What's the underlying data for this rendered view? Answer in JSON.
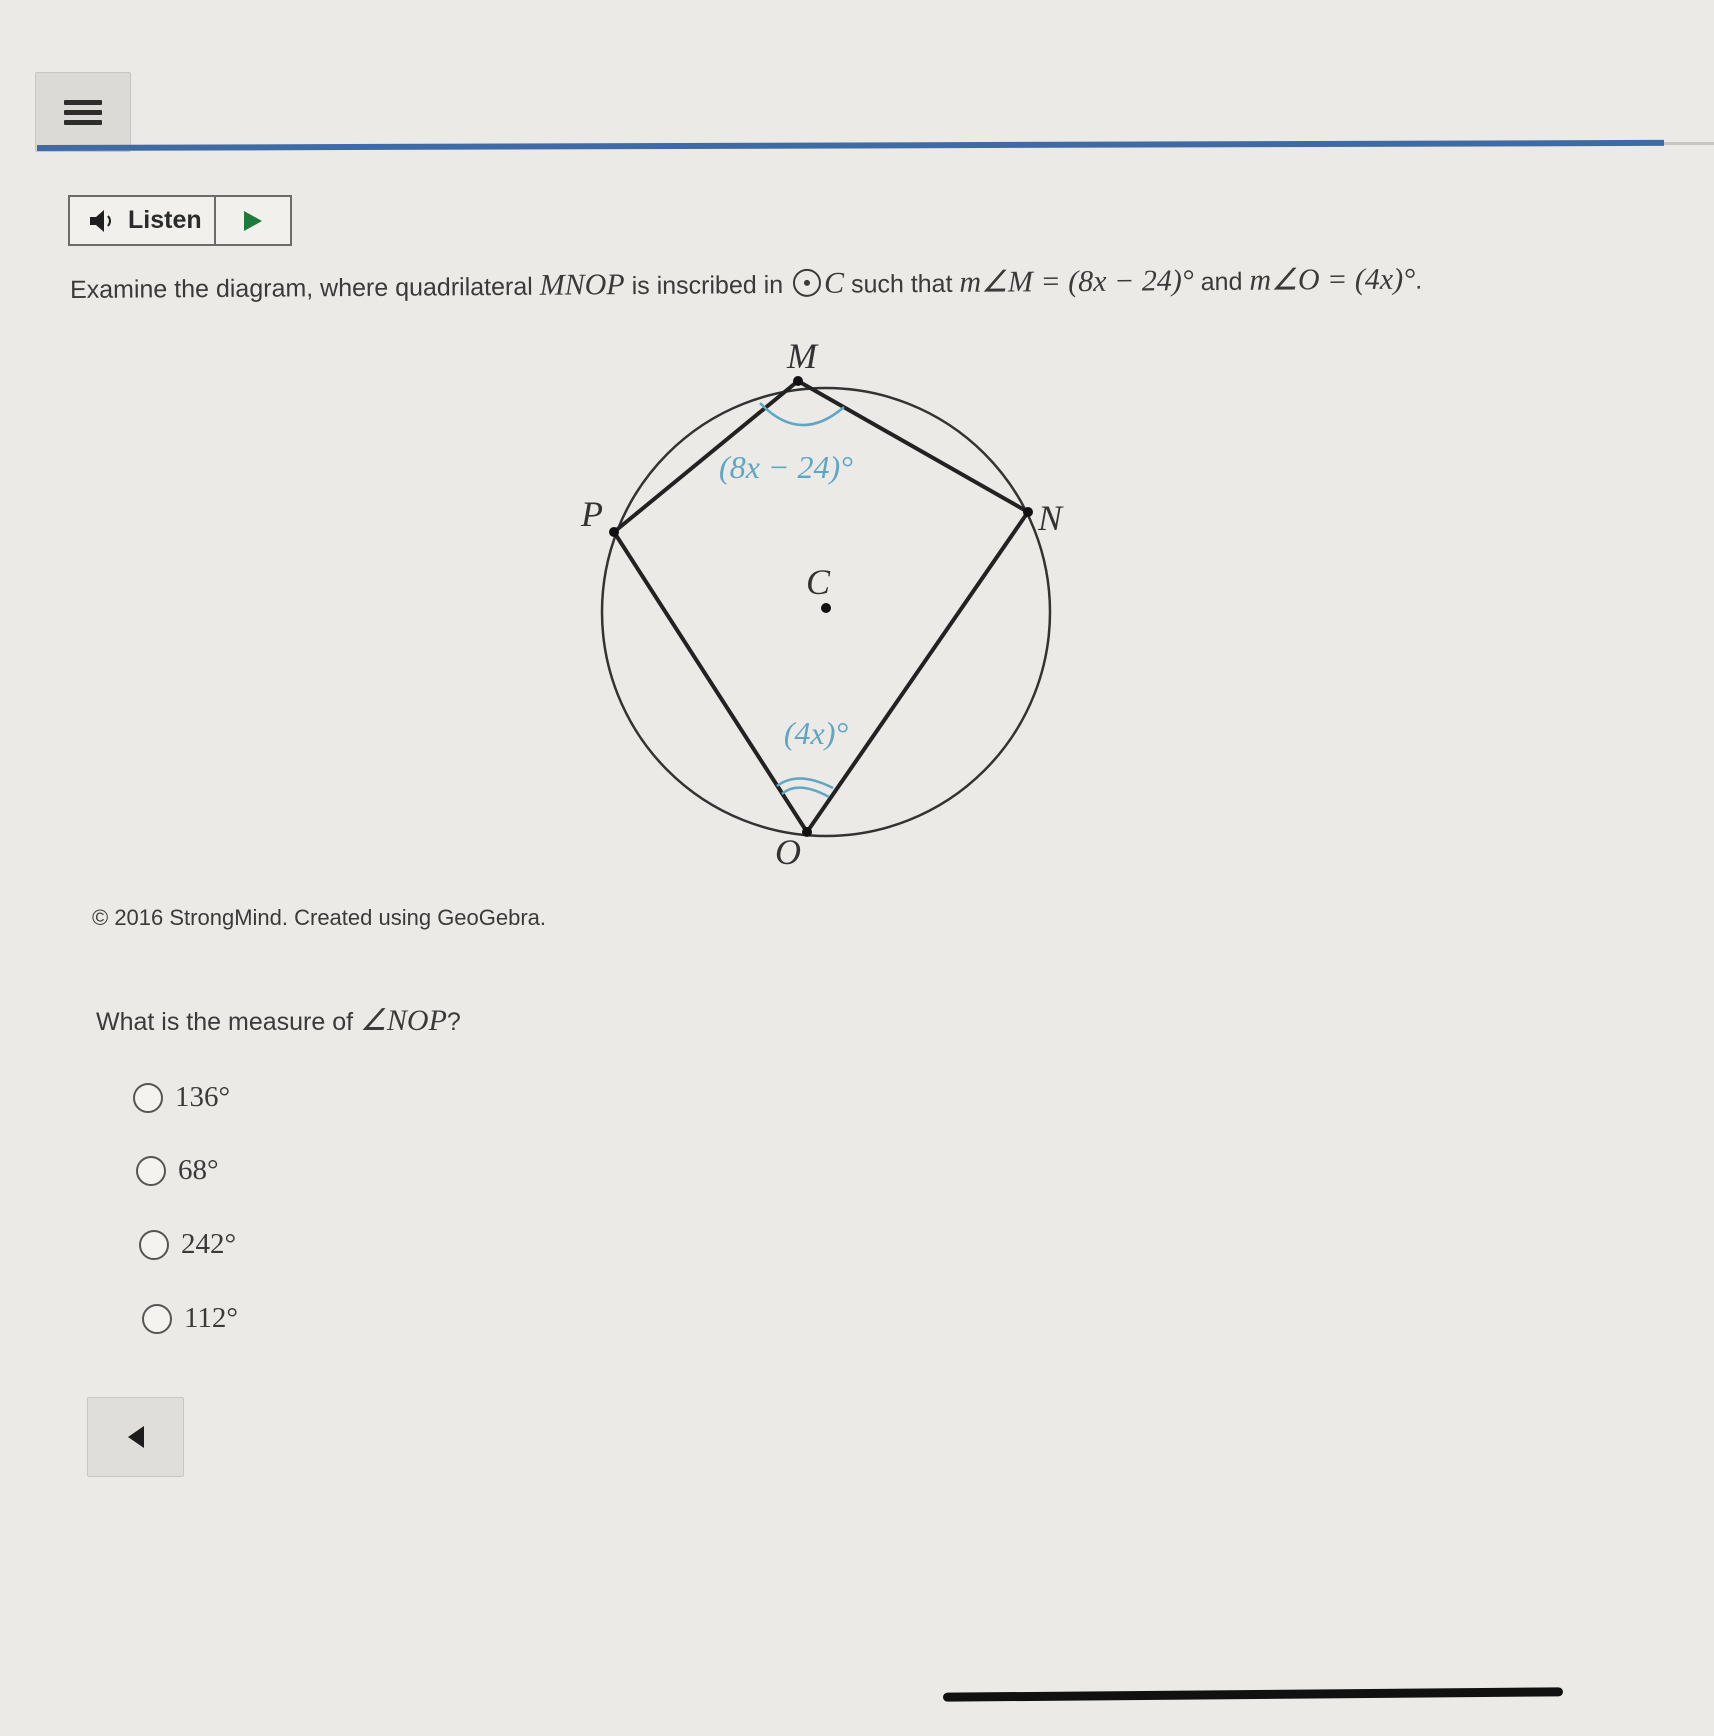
{
  "menu": {
    "icon": "hamburger-menu-icon"
  },
  "listen": {
    "label": "Listen",
    "speaker_icon": "speaker-icon",
    "play_icon": "play-icon"
  },
  "prompt": {
    "t1": "Examine the diagram, where quadrilateral",
    "quad": "MNOP",
    "t2": "is inscribed in",
    "circle": "C",
    "t3": "such that",
    "angle_m": "m∠M = (8x − 24)°",
    "t4": "and",
    "angle_o": "m∠O = (4x)°",
    "t5": "."
  },
  "diagram": {
    "label_m": "M",
    "label_n": "N",
    "label_o": "O",
    "label_p": "P",
    "label_c": "C",
    "angle_m_label": "(8x − 24)°",
    "angle_o_label": "(4x)°",
    "arc_color": "#5ea6c4"
  },
  "copyright": "© 2016 StrongMind. Created using GeoGebra.",
  "question": {
    "text": "What is the measure of",
    "angle": "∠NOP",
    "end": "?"
  },
  "options": [
    {
      "label": "136°"
    },
    {
      "label": "68°"
    },
    {
      "label": "242°"
    },
    {
      "label": "112°"
    }
  ],
  "nav": {
    "back_icon": "left-arrow-icon"
  }
}
